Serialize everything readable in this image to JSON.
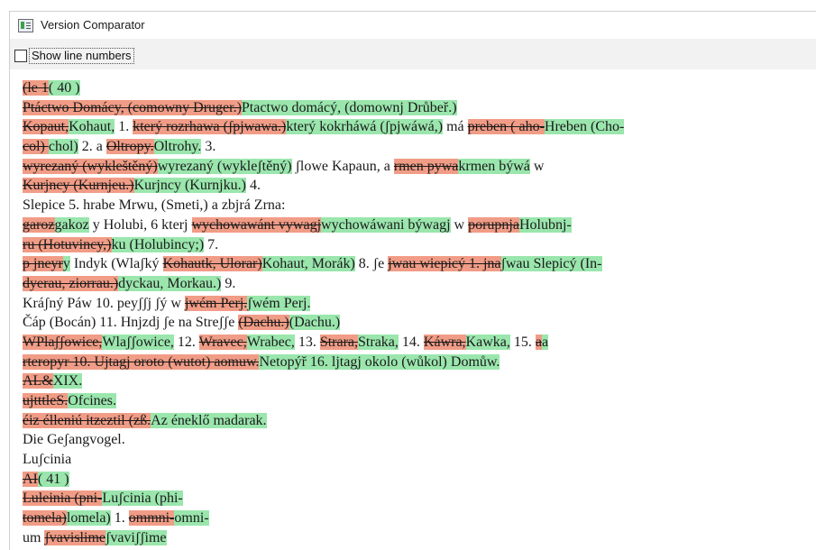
{
  "window": {
    "title": "Version Comparator"
  },
  "toolbar": {
    "show_line_numbers_label": "Show line numbers",
    "show_line_numbers_checked": false
  },
  "colors": {
    "deleted": "#f19c86",
    "inserted": "#9ae6ad"
  },
  "lines": [
    [
      [
        "d",
        "(le 1"
      ],
      [
        "i",
        "( 40 )"
      ]
    ],
    [
      [
        "d",
        "Ptáctwo Domácy, (comowny Druger.)"
      ],
      [
        "i",
        "Ptactwo domácý, (domownj Drůbeř.)"
      ]
    ],
    [
      [
        "d",
        "Kopaut,"
      ],
      [
        "i",
        "Kohaut,"
      ],
      [
        "t",
        " 1. "
      ],
      [
        "d",
        "který rozrhawa (ʃpjwawa.)"
      ],
      [
        "i",
        "který kokrháwá (ʃpjwáwá,)"
      ],
      [
        "t",
        " má "
      ],
      [
        "d",
        "preben ( aho-"
      ],
      [
        "i",
        "Hreben (Cho-"
      ]
    ],
    [
      [
        "d",
        "col) "
      ],
      [
        "i",
        "chol)"
      ],
      [
        "t",
        " 2. a "
      ],
      [
        "d",
        "Oltropy."
      ],
      [
        "i",
        "Oltrohy."
      ],
      [
        "t",
        " 3."
      ]
    ],
    [
      [
        "d",
        "wyrezaný (wykleštěný)"
      ],
      [
        "i",
        "wyrezaný (wykleʃtěný)"
      ],
      [
        "t",
        " ʃlowe Kapaun, a "
      ],
      [
        "d",
        "rmen pywa"
      ],
      [
        "i",
        "krmen býwá"
      ],
      [
        "t",
        " w"
      ]
    ],
    [
      [
        "d",
        "Kurjncy (Kurnjeu.)"
      ],
      [
        "i",
        "Kurjncy (Kurnjku.)"
      ],
      [
        "t",
        " 4."
      ]
    ],
    [
      [
        "t",
        "Slepice 5. hrabe Mrwu, (Smeti,) a zbjrá Zrna:"
      ]
    ],
    [
      [
        "d",
        "garoz"
      ],
      [
        "i",
        "gakoz"
      ],
      [
        "t",
        " y Holubi, 6 kterj "
      ],
      [
        "d",
        "wychowawánt vywagj"
      ],
      [
        "i",
        "wychowáwani býwagj"
      ],
      [
        "t",
        " w "
      ],
      [
        "d",
        "porupnja"
      ],
      [
        "i",
        "Holubnj-"
      ]
    ],
    [
      [
        "d",
        "ru (Hotuvincy,)"
      ],
      [
        "i",
        "ku (Holubincy;)"
      ],
      [
        "t",
        " 7."
      ]
    ],
    [
      [
        "d",
        "p jneyr"
      ],
      [
        "i",
        "y"
      ],
      [
        "t",
        " Indyk (Wlaʃký "
      ],
      [
        "d",
        "Kohautk, Ulorar)"
      ],
      [
        "i",
        "Kohaut, Morák)"
      ],
      [
        "t",
        " 8. ʃe "
      ],
      [
        "d",
        "jwau wiepicý 1. jna"
      ],
      [
        "i",
        "ʃwau Slepicý (In-"
      ]
    ],
    [
      [
        "d",
        "dyerau, ziorrau.)"
      ],
      [
        "i",
        "dyckau, Morkau.)"
      ],
      [
        "t",
        " 9."
      ]
    ],
    [
      [
        "t",
        "Kráʃný Páw 10. peyʃʃj ʃý w "
      ],
      [
        "d",
        "jwém Perj."
      ],
      [
        "i",
        "ʃwém Perj."
      ]
    ],
    [
      [
        "t",
        "Čáp (Bocán) 11. Hnjzdj ʃe na Streʃʃe "
      ],
      [
        "d",
        "(Dachu.)"
      ],
      [
        "i",
        "(Dachu.)"
      ]
    ],
    [
      [
        "d",
        "WPlaʃʃowice,"
      ],
      [
        "i",
        "Wlaʃʃowice,"
      ],
      [
        "t",
        " 12. "
      ],
      [
        "d",
        "Wravec,"
      ],
      [
        "i",
        "Wrabec,"
      ],
      [
        "t",
        " 13. "
      ],
      [
        "d",
        "Strara,"
      ],
      [
        "i",
        "Straka,"
      ],
      [
        "t",
        " 14. "
      ],
      [
        "d",
        "Káwra,"
      ],
      [
        "i",
        "Kawka,"
      ],
      [
        "t",
        " 15. "
      ],
      [
        "d",
        "a"
      ],
      [
        "i",
        "a"
      ]
    ],
    [
      [
        "d",
        "rteropyr 10. Ujtagj oroto (wutot) aomuw."
      ],
      [
        "i",
        "Netopýř 16. ljtagj okolo (wůkol) Domůw."
      ]
    ],
    [
      [
        "d",
        "AL&"
      ],
      [
        "i",
        "XIX."
      ]
    ],
    [
      [
        "d",
        "ujtttleS."
      ],
      [
        "i",
        "Ofcines."
      ]
    ],
    [
      [
        "d",
        "éiz élleniú itzeztil (zß."
      ],
      [
        "i",
        "Az éneklő madarak."
      ]
    ],
    [
      [
        "t",
        "Die Geʃangvogel."
      ]
    ],
    [
      [
        "t",
        "Luʃcinia"
      ]
    ],
    [
      [
        "d",
        "AI"
      ],
      [
        "i",
        "( 41 )"
      ]
    ],
    [
      [
        "d",
        "Luleinia (pni-"
      ],
      [
        "i",
        "Luʃcinia (phi-"
      ]
    ],
    [
      [
        "d",
        "tomela)"
      ],
      [
        "i",
        "lomela)"
      ],
      [
        "t",
        " 1. "
      ],
      [
        "d",
        "ommni-"
      ],
      [
        "i",
        "omni-"
      ]
    ],
    [
      [
        "t",
        "um "
      ],
      [
        "d",
        "ʃvavislime"
      ],
      [
        "i",
        "ʃvaviʃʃime"
      ]
    ]
  ]
}
